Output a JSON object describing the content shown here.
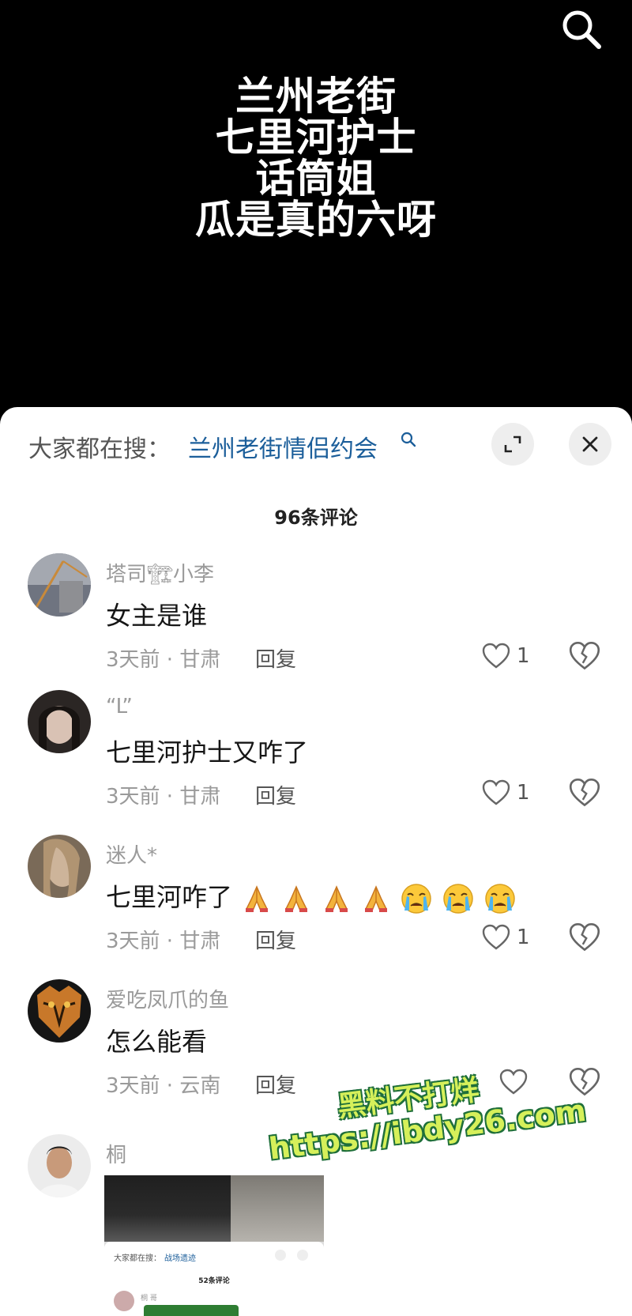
{
  "video": {
    "overlay_lines": [
      "兰州老街",
      "七里河护士",
      "话筒姐",
      "瓜是真的六呀"
    ],
    "search_icon": "search-icon"
  },
  "sheet": {
    "search_prefix": "大家都在搜：",
    "search_term": "兰州老街情侣约会",
    "comment_count": "96条评论",
    "reply_label": "回复"
  },
  "comments": [
    {
      "username": "塔司🏗小李",
      "text": "女主是谁",
      "meta": "3天前 · 甘肃",
      "likes": "1"
    },
    {
      "username": "“L”",
      "text": "七里河护士又咋了",
      "meta": "3天前 · 甘肃",
      "likes": "1"
    },
    {
      "username": "迷人*",
      "text": "七里河咋了",
      "meta": "3天前 · 甘肃",
      "likes": "1"
    },
    {
      "username": "爱吃凤爪的鱼",
      "text": "怎么能看",
      "meta": "3天前 · 云南",
      "likes": ""
    },
    {
      "username": "桐"
    }
  ],
  "attachment": {
    "search_prefix": "大家都在搜：",
    "search_term": "战场遗迹",
    "comment_count": "52条评论",
    "user": "桐 哥"
  },
  "watermark": {
    "line1": "黑料不打烊",
    "line2": "https://ibdy26.com"
  },
  "colors": {
    "search_term": "#1b5e9a",
    "watermark_fill": "#d6f05a",
    "watermark_outline": "#1f6f3a"
  }
}
